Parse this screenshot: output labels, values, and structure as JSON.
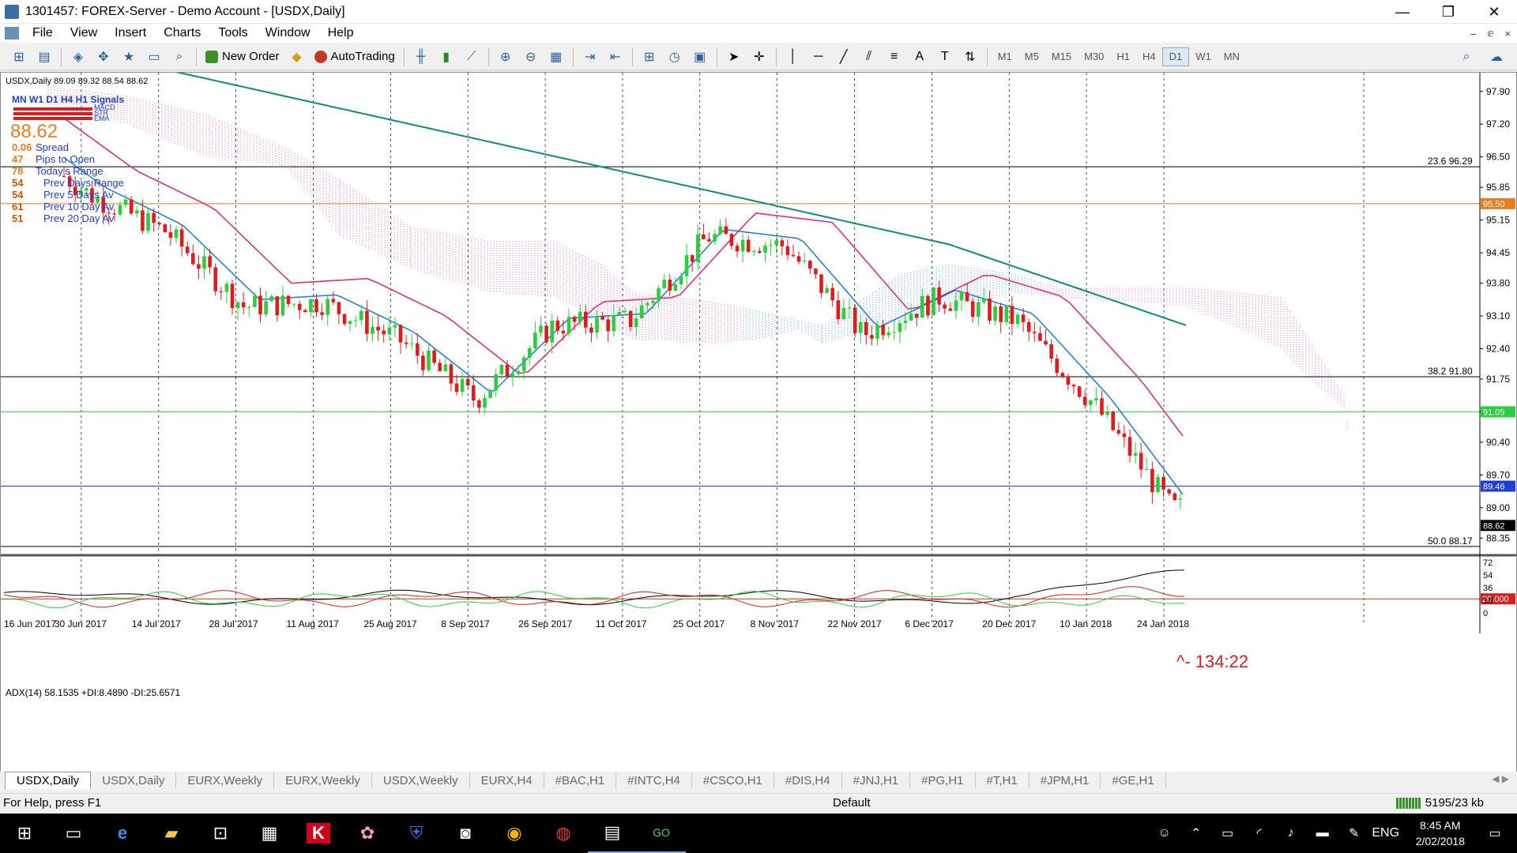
{
  "window": {
    "title": "1301457: FOREX-Server - Demo Account - [USDX,Daily]",
    "controls": {
      "minimize": "—",
      "restore": "❐",
      "close": "✕"
    }
  },
  "menu": [
    "File",
    "View",
    "Insert",
    "Charts",
    "Tools",
    "Window",
    "Help"
  ],
  "mdi_controls": {
    "minimize": "–",
    "restore": "ⅇ",
    "close": "×"
  },
  "toolbar": {
    "new_order": "New Order",
    "autotrading": "AutoTrading",
    "timeframes": [
      "M1",
      "M5",
      "M15",
      "M30",
      "H1",
      "H4",
      "D1",
      "W1",
      "MN"
    ],
    "active_timeframe": "D1"
  },
  "chart": {
    "header": "USDX,Daily  89.09 89.32 88.54 88.62",
    "signals_title": "MN W1 D1 H4 H1 Signals",
    "signal_rows": [
      "MACD",
      "STR",
      "EMA"
    ],
    "big_price": "88.62",
    "info_lines": [
      {
        "value": "0.06",
        "label": "Spread"
      },
      {
        "value": "47",
        "label": "Pips to Open"
      },
      {
        "value": "78",
        "label": "Today's Range"
      },
      {
        "value": "54",
        "label": "Prev Days Range"
      },
      {
        "value": "54",
        "label": "Prev 5 Days Av"
      },
      {
        "value": "61",
        "label": "Prev 10 Day Av"
      },
      {
        "value": "51",
        "label": "Prev 20 Day Av"
      }
    ],
    "fib_labels": [
      {
        "text": "23.6  96.29",
        "price": 96.29
      },
      {
        "text": "38.2  91.80",
        "price": 91.8
      },
      {
        "text": "50.0  88.17",
        "price": 88.17
      }
    ],
    "price_axis": [
      "97.90",
      "97.20",
      "96.50",
      "95.85",
      "95.15",
      "94.45",
      "93.80",
      "93.10",
      "92.40",
      "91.75",
      "91.05",
      "90.40",
      "89.70",
      "89.00",
      "88.35"
    ],
    "price_markers": [
      {
        "text": "95.50",
        "price": 95.5,
        "color": "#e67e22"
      },
      {
        "text": "91.05",
        "price": 91.05,
        "color": "#2ecc40"
      },
      {
        "text": "89.46",
        "price": 89.46,
        "color": "#1f3fd1"
      },
      {
        "text": "88.62",
        "price": 88.62,
        "color": "#000000"
      }
    ],
    "countdown": "^- 134:22",
    "adx_header": "ADX(14) 58.1535 +DI:8.4890 -DI:25.6571",
    "adx_axis": [
      "72",
      "54",
      "36",
      "18",
      "0"
    ],
    "adx_marker": "20.000",
    "date_axis": [
      "16 Jun 2017",
      "30 Jun 2017",
      "14 Jul 2017",
      "28 Jul 2017",
      "11 Aug 2017",
      "25 Aug 2017",
      "8 Sep 2017",
      "26 Sep 2017",
      "11 Oct 2017",
      "25 Oct 2017",
      "8 Nov 2017",
      "22 Nov 2017",
      "6 Dec 2017",
      "20 Dec 2017",
      "10 Jan 2018",
      "24 Jan 2018"
    ]
  },
  "chart_data": {
    "type": "line",
    "title": "USDX,Daily",
    "x": [
      "16 Jun 2017",
      "30 Jun 2017",
      "14 Jul 2017",
      "28 Jul 2017",
      "11 Aug 2017",
      "25 Aug 2017",
      "8 Sep 2017",
      "26 Sep 2017",
      "11 Oct 2017",
      "25 Oct 2017",
      "8 Nov 2017",
      "22 Nov 2017",
      "6 Dec 2017",
      "20 Dec 2017",
      "10 Jan 2018",
      "24 Jan 2018"
    ],
    "series": [
      {
        "values": [
          96.9,
          95.7,
          94.9,
          93.3,
          93.4,
          92.6,
          91.3,
          92.9,
          93.0,
          94.8,
          94.6,
          92.7,
          93.5,
          93.0,
          91.2,
          89.0
        ]
      }
    ],
    "ylim": [
      88.0,
      98.2
    ],
    "grid": true
  },
  "tabs": [
    "USDX,Daily",
    "USDX,Daily",
    "EURX,Weekly",
    "EURX,Weekly",
    "USDX,Weekly",
    "EURX,H4",
    "#BAC,H1",
    "#INTC,H4",
    "#CSCO,H1",
    "#DIS,H4",
    "#JNJ,H1",
    "#PG,H1",
    "#T,H1",
    "#JPM,H1",
    "#GE,H1"
  ],
  "status": {
    "help": "For Help, press F1",
    "profile": "Default",
    "traffic": "5195/23 kb"
  },
  "taskbar": {
    "lang": "ENG",
    "time": "8:45 AM",
    "date": "2/02/2018"
  }
}
